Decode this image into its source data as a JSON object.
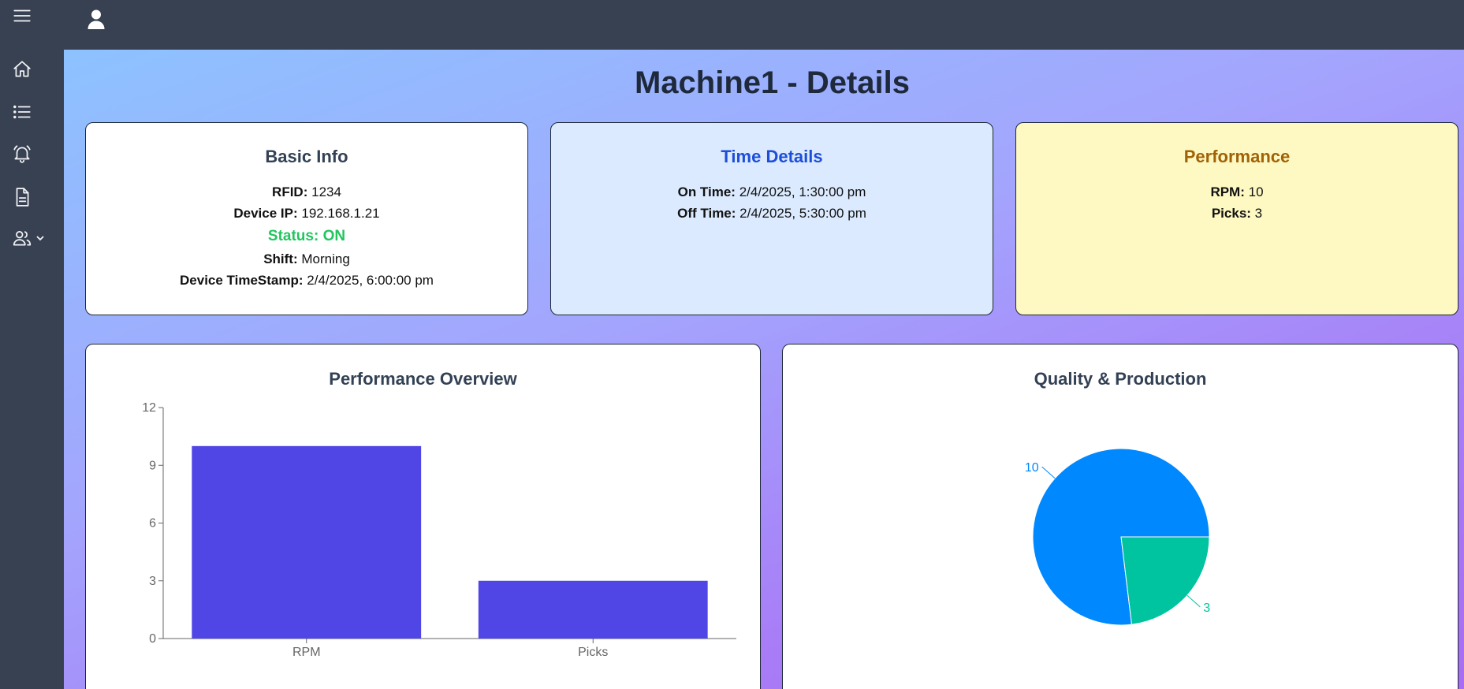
{
  "header": {
    "menu_icon": "hamburger-icon",
    "user_icon": "user-icon"
  },
  "sidebar": {
    "items": [
      {
        "icon": "home-icon"
      },
      {
        "icon": "list-icon"
      },
      {
        "icon": "bell-icon"
      },
      {
        "icon": "document-icon"
      },
      {
        "icon": "users-icon",
        "expand_icon": "chevron-down-icon"
      }
    ]
  },
  "page": {
    "title": "Machine1 - Details"
  },
  "basic_info": {
    "title": "Basic Info",
    "rfid_label": "RFID:",
    "rfid": "1234",
    "ip_label": "Device IP:",
    "ip": "192.168.1.21",
    "status_label": "Status:",
    "status": "ON",
    "shift_label": "Shift:",
    "shift": "Morning",
    "timestamp_label": "Device TimeStamp:",
    "timestamp": "2/4/2025, 6:00:00 pm"
  },
  "time_details": {
    "title": "Time Details",
    "on_label": "On Time:",
    "on_time": "2/4/2025, 1:30:00 pm",
    "off_label": "Off Time:",
    "off_time": "2/4/2025, 5:30:00 pm"
  },
  "performance": {
    "title": "Performance",
    "rpm_label": "RPM:",
    "rpm": "10",
    "picks_label": "Picks:",
    "picks": "3"
  },
  "colors": {
    "bar": "#4f46e5",
    "pie_rpm": "#0088fe",
    "pie_picks": "#00c49f",
    "status_on": "#22c55e"
  },
  "chart_data": [
    {
      "type": "bar",
      "title": "Performance Overview",
      "categories": [
        "RPM",
        "Picks"
      ],
      "values": [
        10,
        3
      ],
      "ylim": [
        0,
        12
      ],
      "yticks": [
        0,
        3,
        6,
        9,
        12
      ],
      "grid": false,
      "legend": "none"
    },
    {
      "type": "pie",
      "title": "Quality & Production",
      "values": [
        10,
        3
      ],
      "labels": [
        "10",
        "3"
      ],
      "legend": "none"
    }
  ]
}
